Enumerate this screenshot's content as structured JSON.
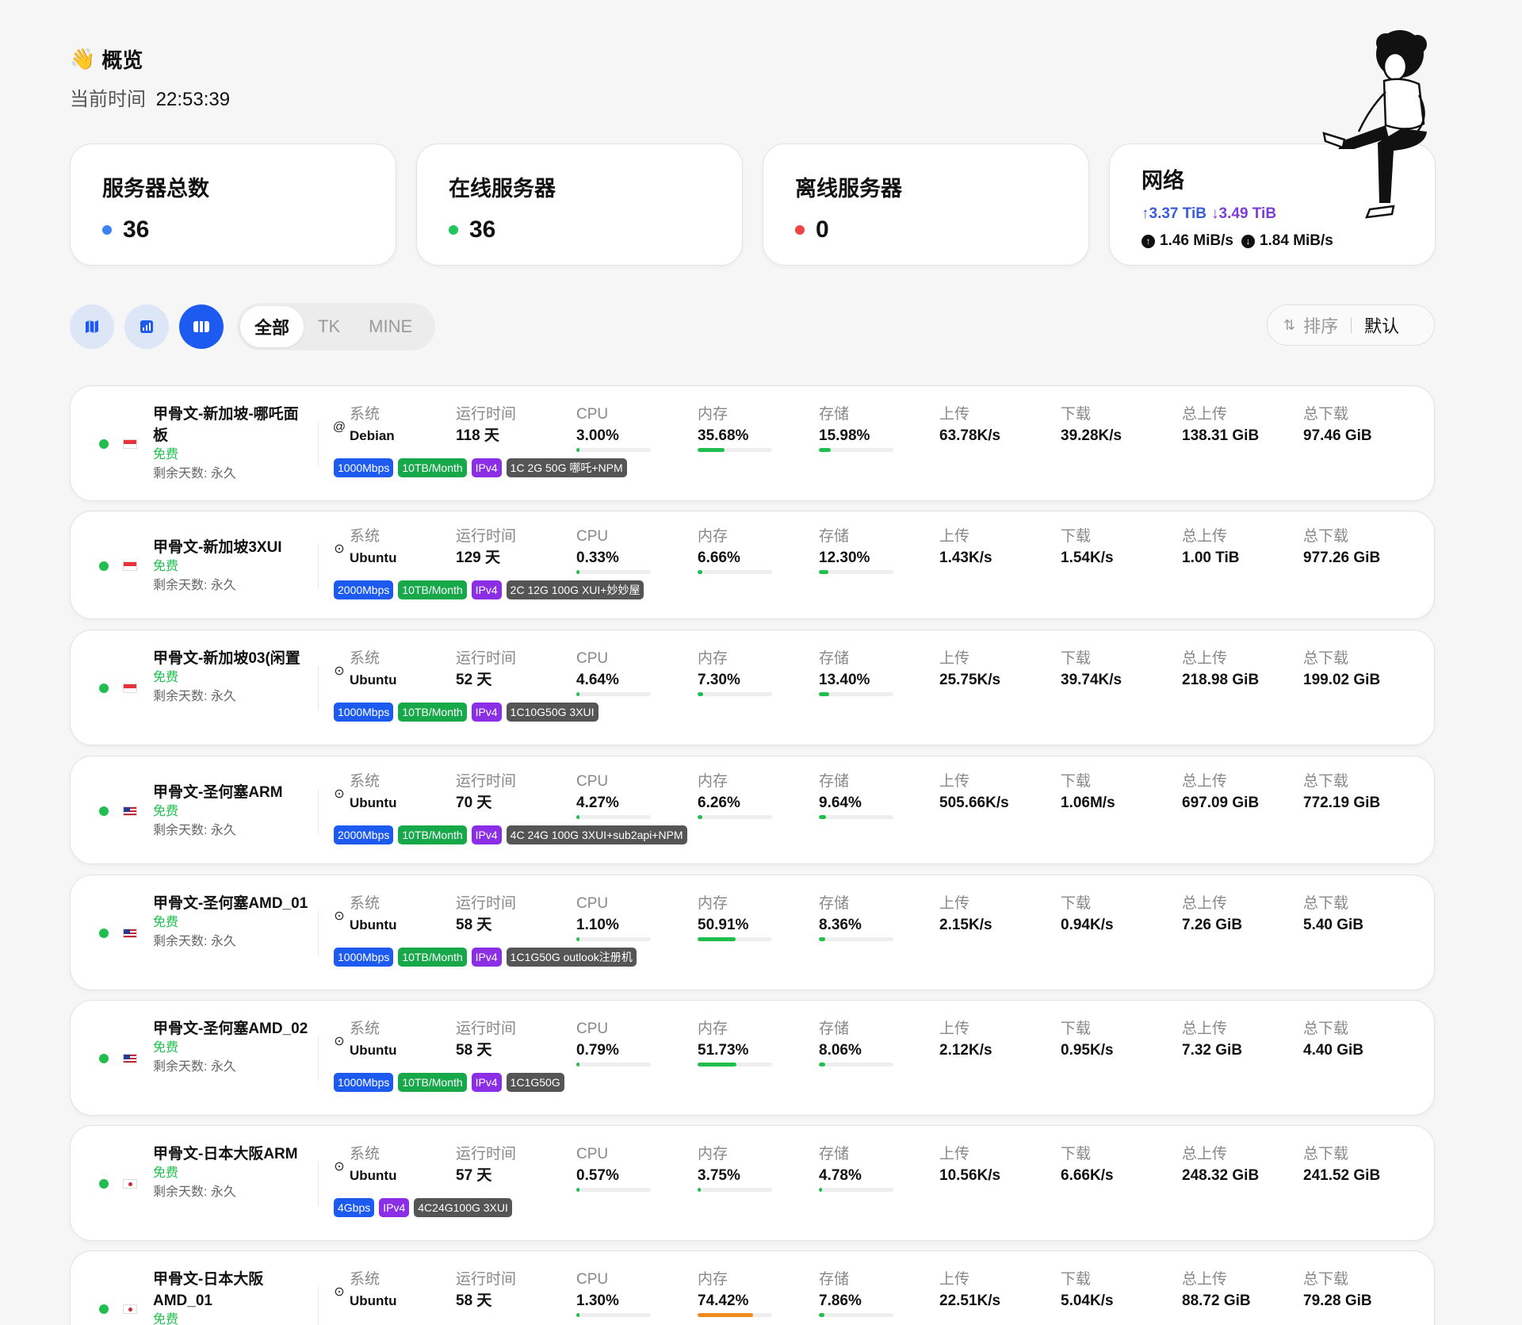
{
  "overview": {
    "emoji": "👋",
    "title": "概览",
    "time_label": "当前时间",
    "time_value": "22:53:39"
  },
  "stats": {
    "total": {
      "label": "服务器总数",
      "value": "36",
      "color": "#3b82f6"
    },
    "online": {
      "label": "在线服务器",
      "value": "36",
      "color": "#22c55e"
    },
    "offline": {
      "label": "离线服务器",
      "value": "0",
      "color": "#ef4444"
    },
    "network": {
      "label": "网络",
      "upload_total": "↑3.37 TiB",
      "download_total": "↓3.49 TiB",
      "upload_speed": "1.46 MiB/s",
      "download_speed": "1.84 MiB/s"
    }
  },
  "toolbar": {
    "views": [
      {
        "icon": "map-icon",
        "active": false
      },
      {
        "icon": "chart-icon",
        "active": false
      },
      {
        "icon": "grid-icon",
        "active": true
      }
    ],
    "filters": [
      "全部",
      "TK",
      "MINE"
    ],
    "active_filter": "全部",
    "sort_label": "排序",
    "sort_value": "默认"
  },
  "labels": {
    "os": "系统",
    "uptime": "运行时间",
    "cpu": "CPU",
    "mem": "内存",
    "disk": "存储",
    "upload": "上传",
    "download": "下载",
    "total_up": "总上传",
    "total_down": "总下载"
  },
  "servers": [
    {
      "name": "甲骨文-新加坡-哪吒面板",
      "price": "免费",
      "days": "剩余天数: 永久",
      "flag": "sg",
      "os_icon": "debian-icon",
      "os": "Debian",
      "uptime": "118 天",
      "cpu": "3.00%",
      "cpu_pct": 3.0,
      "mem": "35.68%",
      "mem_pct": 35.68,
      "disk": "15.98%",
      "disk_pct": 15.98,
      "up": "63.78K/s",
      "down": "39.28K/s",
      "total_up": "138.31 GiB",
      "total_down": "97.46 GiB",
      "tags": [
        {
          "t": "1000Mbps",
          "c": "blue"
        },
        {
          "t": "10TB/Month",
          "c": "green"
        },
        {
          "t": "IPv4",
          "c": "purple"
        },
        {
          "t": "1C 2G 50G 哪吒+NPM",
          "c": "dark"
        }
      ]
    },
    {
      "name": "甲骨文-新加坡3XUI",
      "price": "免费",
      "days": "剩余天数: 永久",
      "flag": "sg",
      "os_icon": "ubuntu-icon",
      "os": "Ubuntu",
      "uptime": "129 天",
      "cpu": "0.33%",
      "cpu_pct": 0.33,
      "mem": "6.66%",
      "mem_pct": 6.66,
      "disk": "12.30%",
      "disk_pct": 12.3,
      "up": "1.43K/s",
      "down": "1.54K/s",
      "total_up": "1.00 TiB",
      "total_down": "977.26 GiB",
      "tags": [
        {
          "t": "2000Mbps",
          "c": "blue"
        },
        {
          "t": "10TB/Month",
          "c": "green"
        },
        {
          "t": "IPv4",
          "c": "purple"
        },
        {
          "t": "2C 12G 100G XUI+妙妙屋",
          "c": "dark"
        }
      ]
    },
    {
      "name": "甲骨文-新加坡03(闲置",
      "price": "免费",
      "days": "剩余天数: 永久",
      "flag": "sg",
      "os_icon": "ubuntu-icon",
      "os": "Ubuntu",
      "uptime": "52 天",
      "cpu": "4.64%",
      "cpu_pct": 4.64,
      "mem": "7.30%",
      "mem_pct": 7.3,
      "disk": "13.40%",
      "disk_pct": 13.4,
      "up": "25.75K/s",
      "down": "39.74K/s",
      "total_up": "218.98 GiB",
      "total_down": "199.02 GiB",
      "tags": [
        {
          "t": "1000Mbps",
          "c": "blue"
        },
        {
          "t": "10TB/Month",
          "c": "green"
        },
        {
          "t": "IPv4",
          "c": "purple"
        },
        {
          "t": "1C10G50G 3XUI",
          "c": "dark"
        }
      ]
    },
    {
      "name": "甲骨文-圣何塞ARM",
      "price": "免费",
      "days": "剩余天数: 永久",
      "flag": "us",
      "os_icon": "ubuntu-icon",
      "os": "Ubuntu",
      "uptime": "70 天",
      "cpu": "4.27%",
      "cpu_pct": 4.27,
      "mem": "6.26%",
      "mem_pct": 6.26,
      "disk": "9.64%",
      "disk_pct": 9.64,
      "up": "505.66K/s",
      "down": "1.06M/s",
      "total_up": "697.09 GiB",
      "total_down": "772.19 GiB",
      "tags": [
        {
          "t": "2000Mbps",
          "c": "blue"
        },
        {
          "t": "10TB/Month",
          "c": "green"
        },
        {
          "t": "IPv4",
          "c": "purple"
        },
        {
          "t": "4C 24G 100G 3XUI+sub2api+NPM",
          "c": "dark"
        }
      ]
    },
    {
      "name": "甲骨文-圣何塞AMD_01",
      "price": "免费",
      "days": "剩余天数: 永久",
      "flag": "us",
      "os_icon": "ubuntu-icon",
      "os": "Ubuntu",
      "uptime": "58 天",
      "cpu": "1.10%",
      "cpu_pct": 1.1,
      "mem": "50.91%",
      "mem_pct": 50.91,
      "disk": "8.36%",
      "disk_pct": 8.36,
      "up": "2.15K/s",
      "down": "0.94K/s",
      "total_up": "7.26 GiB",
      "total_down": "5.40 GiB",
      "tags": [
        {
          "t": "1000Mbps",
          "c": "blue"
        },
        {
          "t": "10TB/Month",
          "c": "green"
        },
        {
          "t": "IPv4",
          "c": "purple"
        },
        {
          "t": "1C1G50G outlook注册机",
          "c": "dark"
        }
      ]
    },
    {
      "name": "甲骨文-圣何塞AMD_02",
      "price": "免费",
      "days": "剩余天数: 永久",
      "flag": "us",
      "os_icon": "ubuntu-icon",
      "os": "Ubuntu",
      "uptime": "58 天",
      "cpu": "0.79%",
      "cpu_pct": 0.79,
      "mem": "51.73%",
      "mem_pct": 51.73,
      "disk": "8.06%",
      "disk_pct": 8.06,
      "up": "2.12K/s",
      "down": "0.95K/s",
      "total_up": "7.32 GiB",
      "total_down": "4.40 GiB",
      "tags": [
        {
          "t": "1000Mbps",
          "c": "blue"
        },
        {
          "t": "10TB/Month",
          "c": "green"
        },
        {
          "t": "IPv4",
          "c": "purple"
        },
        {
          "t": "1C1G50G",
          "c": "dark"
        }
      ]
    },
    {
      "name": "甲骨文-日本大阪ARM",
      "price": "免费",
      "days": "剩余天数: 永久",
      "flag": "jp",
      "os_icon": "ubuntu-icon",
      "os": "Ubuntu",
      "uptime": "57 天",
      "cpu": "0.57%",
      "cpu_pct": 0.57,
      "mem": "3.75%",
      "mem_pct": 3.75,
      "disk": "4.78%",
      "disk_pct": 4.78,
      "up": "10.56K/s",
      "down": "6.66K/s",
      "total_up": "248.32 GiB",
      "total_down": "241.52 GiB",
      "tags": [
        {
          "t": "4Gbps",
          "c": "blue"
        },
        {
          "t": "IPv4",
          "c": "purple"
        },
        {
          "t": "4C24G100G 3XUI",
          "c": "dark"
        }
      ]
    },
    {
      "name": "甲骨文-日本大阪AMD_01",
      "price": "免费",
      "days": "",
      "flag": "jp",
      "os_icon": "ubuntu-icon",
      "os": "Ubuntu",
      "uptime": "58 天",
      "cpu": "1.30%",
      "cpu_pct": 1.3,
      "mem": "74.42%",
      "mem_pct": 74.42,
      "disk": "7.86%",
      "disk_pct": 7.86,
      "up": "22.51K/s",
      "down": "5.04K/s",
      "total_up": "88.72 GiB",
      "total_down": "79.28 GiB",
      "tags": []
    }
  ]
}
